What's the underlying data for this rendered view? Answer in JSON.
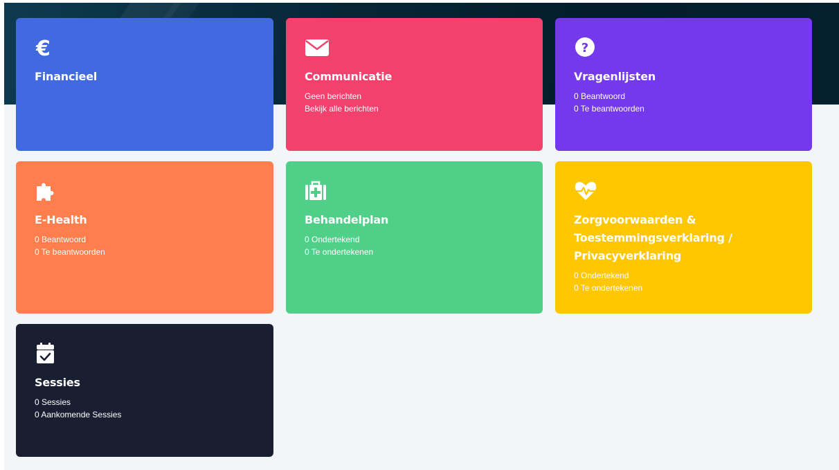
{
  "tiles": {
    "financieel": {
      "title": "Financieel",
      "icon": "euro-icon",
      "color": "#416ae0"
    },
    "communicatie": {
      "title": "Communicatie",
      "icon": "envelope-icon",
      "color": "#f2416d",
      "lines": [
        "Geen berichten",
        "Bekijk alle berichten"
      ]
    },
    "vragenlijsten": {
      "title": "Vragenlijsten",
      "icon": "question-circle-icon",
      "color": "#7339ea",
      "lines": [
        "0 Beantwoord",
        "0 Te beantwoorden"
      ]
    },
    "ehealth": {
      "title": "E-Health",
      "icon": "puzzle-piece-icon",
      "color": "#ff7e4e",
      "lines": [
        "0 Beantwoord",
        "0 Te beantwoorden"
      ]
    },
    "behandelplan": {
      "title": "Behandelplan",
      "icon": "medkit-icon",
      "color": "#50cf89",
      "lines": [
        "0 Ondertekend",
        "0 Te ondertekenen"
      ]
    },
    "zorgvoorwaarden": {
      "title_lines": [
        "Zorgvoorwaarden &",
        "Toestemmingsverklaring /",
        "Privacyverklaring"
      ],
      "icon": "heartbeat-icon",
      "color": "#ffc700",
      "lines": [
        "0 Ondertekend",
        "0 Te ondertekenen"
      ]
    },
    "sessies": {
      "title": "Sessies",
      "icon": "calendar-check-icon",
      "color": "#1a1e31",
      "lines": [
        "0 Sessies",
        "0 Aankomende Sessies"
      ]
    }
  }
}
